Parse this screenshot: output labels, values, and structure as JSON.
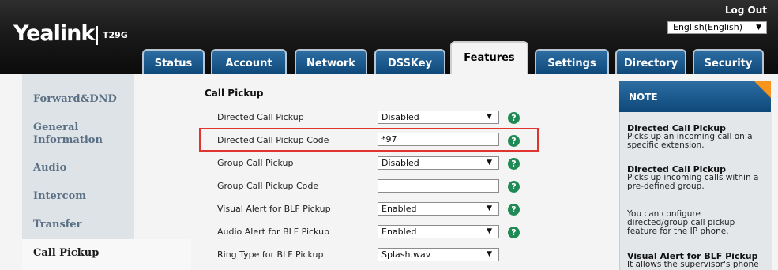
{
  "header": {
    "brand": "Yealink",
    "model": "T29G",
    "logout_label": "Log Out",
    "language": "English(English)",
    "tabs": [
      {
        "label": "Status"
      },
      {
        "label": "Account"
      },
      {
        "label": "Network"
      },
      {
        "label": "DSSKey"
      },
      {
        "label": "Features"
      },
      {
        "label": "Settings"
      },
      {
        "label": "Directory"
      },
      {
        "label": "Security"
      }
    ],
    "active_tab": "Features"
  },
  "sidebar": {
    "items": [
      {
        "label": "Forward&DND"
      },
      {
        "label": "General Information"
      },
      {
        "label": "Audio"
      },
      {
        "label": "Intercom"
      },
      {
        "label": "Transfer"
      },
      {
        "label": "Call Pickup"
      }
    ],
    "active_item": "Call Pickup"
  },
  "main": {
    "section_title": "Call Pickup",
    "rows": [
      {
        "label": "Directed Call Pickup",
        "type": "select",
        "value": "Disabled"
      },
      {
        "label": "Directed Call Pickup Code",
        "type": "input",
        "value": "*97"
      },
      {
        "label": "Group Call Pickup",
        "type": "select",
        "value": "Disabled"
      },
      {
        "label": "Group Call Pickup Code",
        "type": "input",
        "value": ""
      },
      {
        "label": "Visual Alert for BLF Pickup",
        "type": "select",
        "value": "Enabled"
      },
      {
        "label": "Audio Alert for BLF Pickup",
        "type": "select",
        "value": "Enabled"
      },
      {
        "label": "Ring Type for BLF Pickup",
        "type": "select",
        "value": "Splash.wav"
      }
    ],
    "help_icon": "?",
    "highlight_color": "#e0342e"
  },
  "note": {
    "title": "NOTE",
    "entries": [
      {
        "heading": "Directed Call Pickup",
        "text": "Picks up an incoming call on a specific extension."
      },
      {
        "heading": "Directed Call Pickup",
        "text": "Picks up incoming calls within a pre-defined group."
      },
      {
        "heading": "",
        "text": "You can configure directed/group call pickup feature for the IP phone."
      },
      {
        "heading": "Visual Alert for BLF Pickup",
        "text": "It allows the supervisor's phone"
      }
    ]
  },
  "colors": {
    "tab_blue": "#0e4879",
    "help_green": "#1f8a56",
    "note_accent": "#f7941d"
  }
}
